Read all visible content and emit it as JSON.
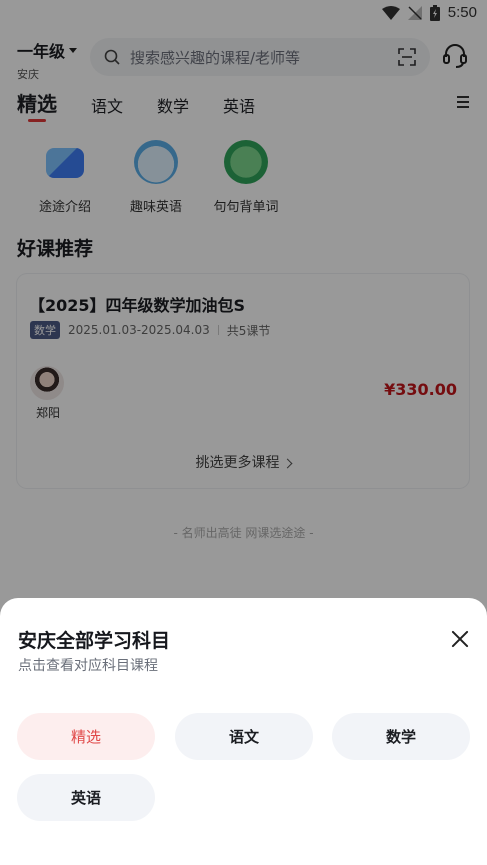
{
  "status_bar": {
    "time": "5:50"
  },
  "header": {
    "grade": "一年级",
    "city": "安庆",
    "search_placeholder": "搜索感兴趣的课程/老师等"
  },
  "tabs": [
    "精选",
    "语文",
    "数学",
    "英语"
  ],
  "quick_entries": [
    {
      "label": "途途介绍",
      "icon": "chat-bubble-icon"
    },
    {
      "label": "趣味英语",
      "icon": "hi-mascot-icon"
    },
    {
      "label": "句句背单词",
      "icon": "dinosaur-mascot-icon"
    }
  ],
  "section_title": "好课推荐",
  "course": {
    "title": "【2025】四年级数学加油包S",
    "subject": "数学",
    "dates": "2025.01.03-2025.04.03",
    "lessons": "共5课节",
    "teacher": "郑阳",
    "price": "¥330.00",
    "more_label": "挑选更多课程"
  },
  "footer_slogan": "- 名师出高徒 网课选途途 -",
  "sheet": {
    "title": "安庆全部学习科目",
    "subtitle": "点击查看对应科目课程",
    "options": [
      "精选",
      "语文",
      "数学",
      "英语"
    ],
    "selected": "精选"
  },
  "colors": {
    "accent": "#e04848",
    "price": "#c4161c",
    "badge": "#4b5a86"
  }
}
